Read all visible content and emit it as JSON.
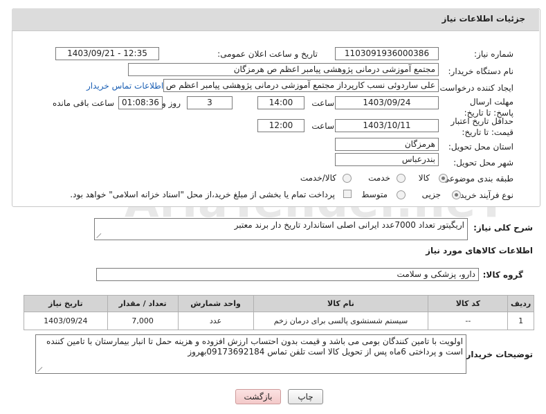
{
  "panel": {
    "title": "جزئیات اطلاعات نیاز"
  },
  "fields": {
    "need_number_label": "شماره نیاز:",
    "need_number": "1103091936000386",
    "announce_label": "تاریخ و ساعت اعلان عمومی:",
    "announce_value": "1403/09/21 - 12:35",
    "buyer_label": "نام دستگاه خریدار:",
    "buyer_value": "مجتمع آموزشی درمانی پژوهشی پیامبر اعظم ص  هرمزگان",
    "creator_label": "ایجاد کننده درخواست:",
    "creator_value": "علی ساردوئی نسب کارپرداز مجتمع آموزشی درمانی پژوهشی پیامبر اعظم ص",
    "contact_link": "اطلاعات تماس خریدار",
    "deadline_label": "مهلت ارسال پاسخ: تا تاریخ:",
    "deadline_date": "1403/09/24",
    "time_word": "ساعت",
    "deadline_time": "14:00",
    "days_value": "3",
    "days_word": "روز و",
    "remaining_time": "01:08:36",
    "remaining_word": "ساعت باقی مانده",
    "validity_label": "حداقل تاریخ اعتبار قیمت: تا تاریخ:",
    "validity_date": "1403/10/11",
    "validity_time": "12:00",
    "province_label": "استان محل تحویل:",
    "province_value": "هرمزگان",
    "city_label": "شهر محل تحویل:",
    "city_value": "بندرعباس",
    "category_label": "طبقه بندی موضوعی:",
    "category_options": [
      "کالا",
      "خدمت",
      "کالا/خدمت"
    ],
    "category_selected": "کالا",
    "process_label": "نوع فرآیند خرید :",
    "process_options": [
      "جزیی",
      "متوسط"
    ],
    "process_note": "پرداخت تمام یا بخشی از مبلغ خرید،از محل \"اسناد خزانه اسلامی\" خواهد بود."
  },
  "general_desc": {
    "label": "شرح کلی نیاز:",
    "value": "اریگیتور تعداد 7000عدد ایرانی اصلی استاندارد تاریخ دار برند معتبر"
  },
  "goods_info": {
    "title": "اطلاعات کالاهای مورد نیاز",
    "group_label": "گروه کالا:",
    "group_value": "دارو، پزشکی و سلامت"
  },
  "table": {
    "headers": [
      "ردیف",
      "کد کالا",
      "نام کالا",
      "واحد شمارش",
      "تعداد / مقدار",
      "تاریخ نیاز"
    ],
    "rows": [
      {
        "row": "1",
        "code": "--",
        "name": "سیستم شستشوی پالسی برای درمان زخم",
        "unit": "عدد",
        "qty": "7,000",
        "date": "1403/09/24"
      }
    ]
  },
  "buyer_notes": {
    "label": "توضیحات خریدار:",
    "value": "اولویت با تامین کنندگان بومی می باشد و قیمت بدون احتساب ارزش افزوده و هزینه حمل تا انبار بیمارستان با تامین کننده است و پرداختی 6ماه پس از تحویل کالا است تلفن تماس 09173692184بهروز"
  },
  "buttons": {
    "print": "چاپ",
    "back": "بازگشت"
  },
  "watermark": "AriaTender.neT"
}
